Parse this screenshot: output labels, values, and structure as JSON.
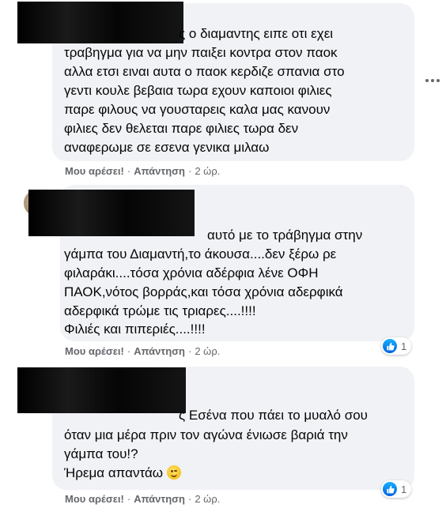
{
  "comments": [
    {
      "lines": [
        "ς ο διαμαντης ειπε οτι εχει",
        "τραβηγμα για να μην παιξει κοντρα στον παοκ",
        "αλλα ετσι ειναι αυτα ο παοκ κερδιζε σπανια στο",
        "γεντι κουλε βεβαια τωρα εχουν καποιοι φιλιες",
        "παρε φιλους να γουσταρεις καλα μας κανουν",
        "φιλιες δεν θελεται παρε φιλιες τωρα δεν",
        "αναφερωμε σε εσενα γενικα μιλαω"
      ],
      "like_label": "Μου αρέσει!",
      "reply_label": "Απάντηση",
      "time": "2 ώρ."
    },
    {
      "lines": [
        "αυτό με το τράβηγμα στην",
        "γάμπα του Διαμαντή,το άκουσα....δεν ξέρω ρε",
        "φιλαράκι....τόσα χρόνια αδέρφια λένε ΟΦΗ",
        "ΠΑΟΚ,νότος βορράς,και τόσα χρόνια αδερφικά",
        "αδερφικά τρώμε τις τριαρες....!!!!",
        "Φιλιές και πιπεριές....!!!!"
      ],
      "like_label": "Μου αρέσει!",
      "reply_label": "Απάντηση",
      "time": "2 ώρ.",
      "reaction_count": "1"
    },
    {
      "lines": [
        "ς Εσένα που πάει το μυαλό σου",
        "όταν μια μέρα πριν τον αγώνα ένιωσε βαριά την",
        "γάμπα του!?",
        "Ήρεμα απαντάω"
      ],
      "like_label": "Μου αρέσει!",
      "reply_label": "Απάντηση",
      "time": "2 ώρ.",
      "reaction_count": "1"
    }
  ],
  "colors": {
    "bubble": "#f0f2f5",
    "meta_text": "#65676b",
    "like_blue": "#1877f2"
  },
  "icons": {
    "more": "more-horizontal-icon",
    "like": "like-thumb-icon",
    "emoji": "wink-emoji-icon"
  }
}
